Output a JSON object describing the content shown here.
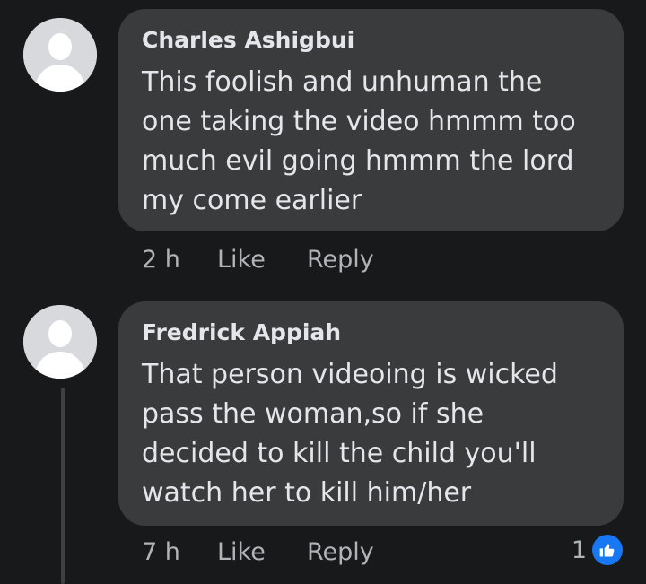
{
  "comments": [
    {
      "author": "Charles Ashigbui",
      "lines": [
        "This foolish and unhuman the",
        "one taking the video hmmm too",
        "much evil going hmmm the lord",
        "my come earlier"
      ],
      "time": "2 h",
      "like_label": "Like",
      "reply_label": "Reply"
    },
    {
      "author": "Fredrick Appiah",
      "lines": [
        "That person videoing is wicked",
        "pass the woman,so if she",
        "decided to kill the child you'll",
        "watch her to kill him/her"
      ],
      "time": "7 h",
      "like_label": "Like",
      "reply_label": "Reply",
      "reaction_count": "1",
      "reaction_icon": "thumbs-up-icon"
    }
  ],
  "colors": {
    "background": "#18191a",
    "bubble": "#3a3b3c",
    "text": "#e4e6eb",
    "secondary_text": "#b0b3b8",
    "like_blue": "#1877f2"
  }
}
